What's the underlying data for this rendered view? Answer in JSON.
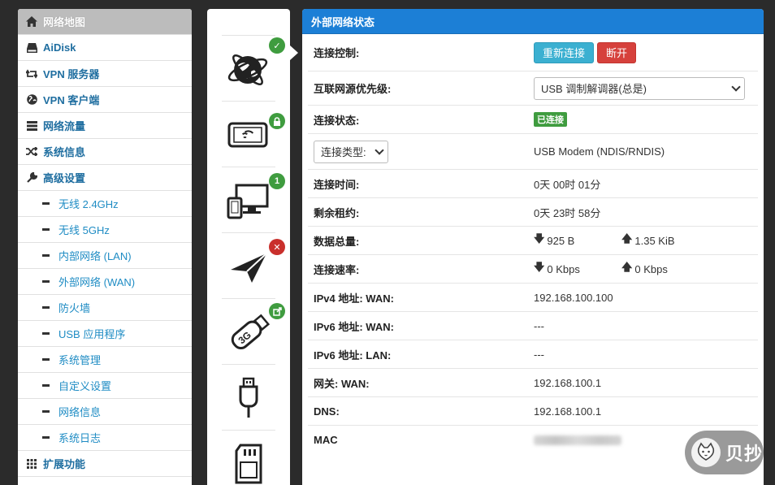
{
  "sidebar": {
    "items": [
      {
        "label": "网络地图",
        "icon": "home-icon"
      },
      {
        "label": "AiDisk",
        "icon": "hdd-icon"
      },
      {
        "label": "VPN 服务器",
        "icon": "retweet-icon"
      },
      {
        "label": "VPN 客户端",
        "icon": "globe-icon"
      },
      {
        "label": "网络流量",
        "icon": "tasks-icon"
      },
      {
        "label": "系统信息",
        "icon": "random-icon"
      },
      {
        "label": "高级设置",
        "icon": "wrench-icon"
      }
    ],
    "subitems": [
      "无线 2.4GHz",
      "无线 5GHz",
      "内部网络 (LAN)",
      "外部网络 (WAN)",
      "防火墙",
      "USB 应用程序",
      "系统管理",
      "自定义设置",
      "网络信息",
      "系统日志"
    ],
    "extensions": {
      "label": "扩展功能",
      "icon": "th-icon"
    }
  },
  "status_icons": {
    "internet_badge": "✓",
    "wireless_badge": "lock",
    "clients_badge": "1",
    "send_badge": "✕",
    "usb_modem_badge": "share"
  },
  "panel": {
    "title": "外部网络状态",
    "connection_control": {
      "label": "连接控制:",
      "reconnect": "重新连接",
      "disconnect": "断开"
    },
    "priority": {
      "label": "互联网源优先级:",
      "selected": "USB 调制解调器(总是)"
    },
    "state": {
      "label": "连接状态:",
      "value": "已连接"
    },
    "conn_type": {
      "selected": "连接类型:",
      "value": "USB Modem (NDIS/RNDIS)"
    },
    "uptime": {
      "label": "连接时间:",
      "value": "0天 00时 01分"
    },
    "lease": {
      "label": "剩余租约:",
      "value": "0天 23时 58分"
    },
    "total": {
      "label": "数据总量:",
      "down": "925 B",
      "up": "1.35 KiB"
    },
    "speed": {
      "label": "连接速率:",
      "down": "0 Kbps",
      "up": "0 Kbps"
    },
    "ipv4_wan": {
      "label": "IPv4 地址: WAN:",
      "value": "192.168.100.100"
    },
    "ipv6_wan": {
      "label": "IPv6 地址: WAN:",
      "value": "---"
    },
    "ipv6_lan": {
      "label": "IPv6 地址: LAN:",
      "value": "---"
    },
    "gateway": {
      "label": "网关: WAN:",
      "value": "192.168.100.1"
    },
    "dns": {
      "label": "DNS:",
      "value": "192.168.100.1"
    },
    "mac": {
      "label": "MAC"
    }
  },
  "watermark": {
    "text": "贝抄"
  },
  "colors": {
    "accent": "#1c7fd6",
    "success": "#3f9c3f",
    "danger": "#d6413c",
    "info": "#3bb0d1",
    "link": "#1f8cc4"
  }
}
